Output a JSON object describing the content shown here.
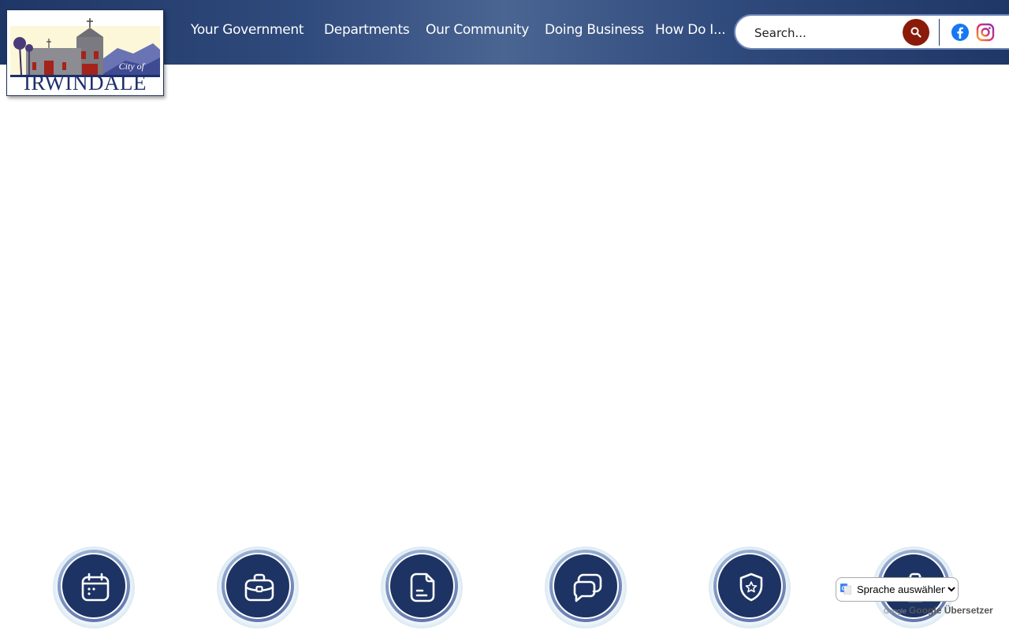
{
  "logo": {
    "city_of": "City of",
    "name": "IRWINDALE"
  },
  "nav": {
    "items": [
      {
        "label": "Your Government"
      },
      {
        "label": "Departments"
      },
      {
        "label": "Our Community"
      },
      {
        "label": "Doing Business"
      },
      {
        "label": "How Do I..."
      }
    ]
  },
  "search": {
    "placeholder": "Search..."
  },
  "social": {
    "facebook_color": "#1877f2",
    "instagram_color": "#e1306c"
  },
  "colors": {
    "header": "#2f4a7c",
    "search_button": "#8a1b0a",
    "quick_icon_bg": "#1d3363"
  },
  "quick_links": [
    {
      "icon": "calendar-icon"
    },
    {
      "icon": "briefcase-icon"
    },
    {
      "icon": "document-icon"
    },
    {
      "icon": "chat-bubbles-icon"
    },
    {
      "icon": "shield-star-icon"
    },
    {
      "icon": "clipboard-icon"
    }
  ],
  "translate": {
    "selected": "Sprache auswählen",
    "powered_by_logo": "Google",
    "powered_by": "Google Übersetzer"
  }
}
